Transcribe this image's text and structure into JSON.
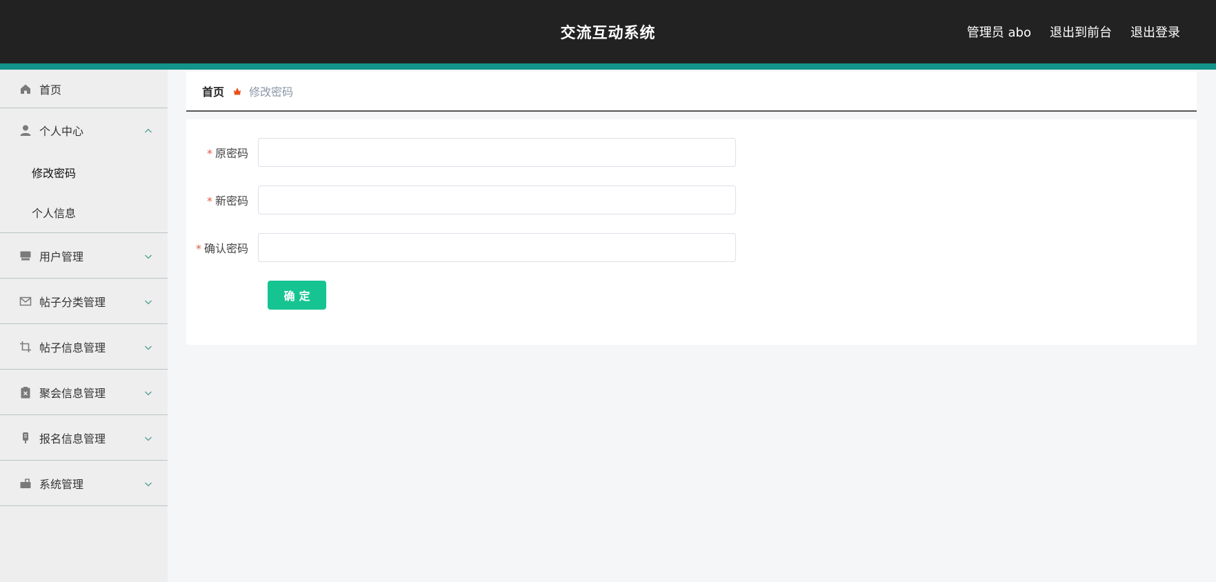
{
  "header": {
    "title": "交流互动系统",
    "user_label": "管理员 abo",
    "to_frontend": "退出到前台",
    "logout": "退出登录",
    "background_color": "#222222",
    "accent_color": "#13948a"
  },
  "sidebar": {
    "home": {
      "label": "首页",
      "icon": "home-icon"
    },
    "personal": {
      "label": "个人中心",
      "icon": "user-icon",
      "expanded": true,
      "children": [
        {
          "label": "修改密码",
          "active": true
        },
        {
          "label": "个人信息",
          "active": false
        }
      ]
    },
    "items": [
      {
        "label": "用户管理",
        "icon": "monitor-icon"
      },
      {
        "label": "帖子分类管理",
        "icon": "mail-icon"
      },
      {
        "label": "帖子信息管理",
        "icon": "crop-icon"
      },
      {
        "label": "聚会信息管理",
        "icon": "clipboard-x-icon"
      },
      {
        "label": "报名信息管理",
        "icon": "microphone-icon"
      },
      {
        "label": "系统管理",
        "icon": "briefcase-icon"
      }
    ]
  },
  "breadcrumb": {
    "home": "首页",
    "current": "修改密码",
    "separator_icon": "flame-icon"
  },
  "form": {
    "fields": [
      {
        "label": "原密码",
        "required": true,
        "value": ""
      },
      {
        "label": "新密码",
        "required": true,
        "value": ""
      },
      {
        "label": "确认密码",
        "required": true,
        "value": ""
      }
    ],
    "required_mark": "*",
    "submit_label": "确定",
    "submit_color": "#16c492"
  }
}
